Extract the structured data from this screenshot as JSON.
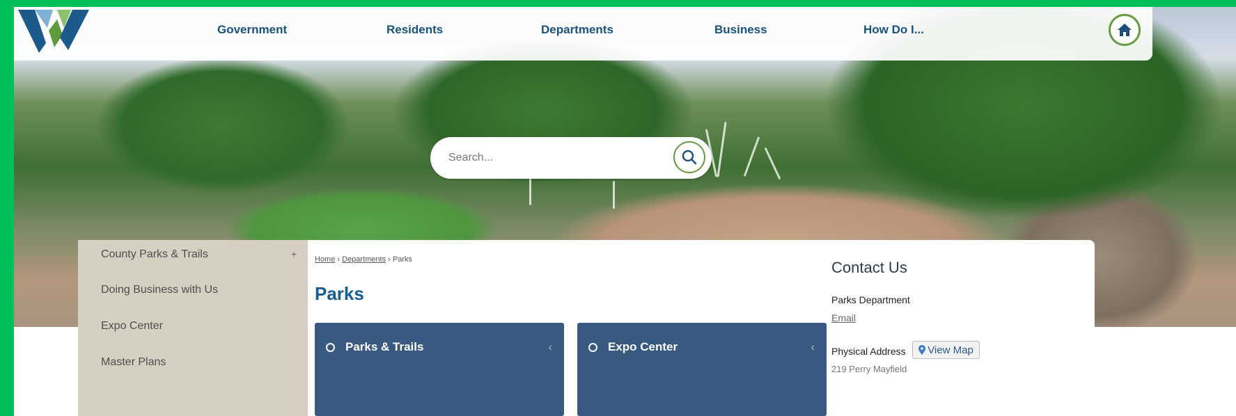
{
  "header": {
    "nav": [
      {
        "label": "Government"
      },
      {
        "label": "Residents"
      },
      {
        "label": "Departments"
      },
      {
        "label": "Business"
      },
      {
        "label": "How Do I..."
      }
    ],
    "home_icon": "home-icon"
  },
  "search": {
    "placeholder": "Search...",
    "icon": "search-icon"
  },
  "sidebar": {
    "items": [
      {
        "label": "County Parks & Trails",
        "expander": "+"
      },
      {
        "label": "Doing Business with Us"
      },
      {
        "label": "Expo Center"
      },
      {
        "label": "Master Plans"
      }
    ]
  },
  "breadcrumb": {
    "home": "Home",
    "sep1": " › ",
    "departments": "Departments",
    "sep2": " › ",
    "current": "Parks"
  },
  "main": {
    "title": "Parks",
    "cards": [
      {
        "label": "Parks & Trails",
        "chevron": "‹"
      },
      {
        "label": "Expo Center",
        "chevron": "‹"
      }
    ]
  },
  "contact": {
    "title": "Contact Us",
    "department": "Parks Department",
    "email": "Email",
    "address_label": "Physical Address",
    "view_map": "View Map",
    "address_line": "219 Perry Mayfield"
  },
  "colors": {
    "frame": "#00c05a",
    "nav_text": "#19527c",
    "card_bg": "#385a80",
    "title": "#175b8f",
    "sidebar_bg": "#d7d0c2"
  }
}
